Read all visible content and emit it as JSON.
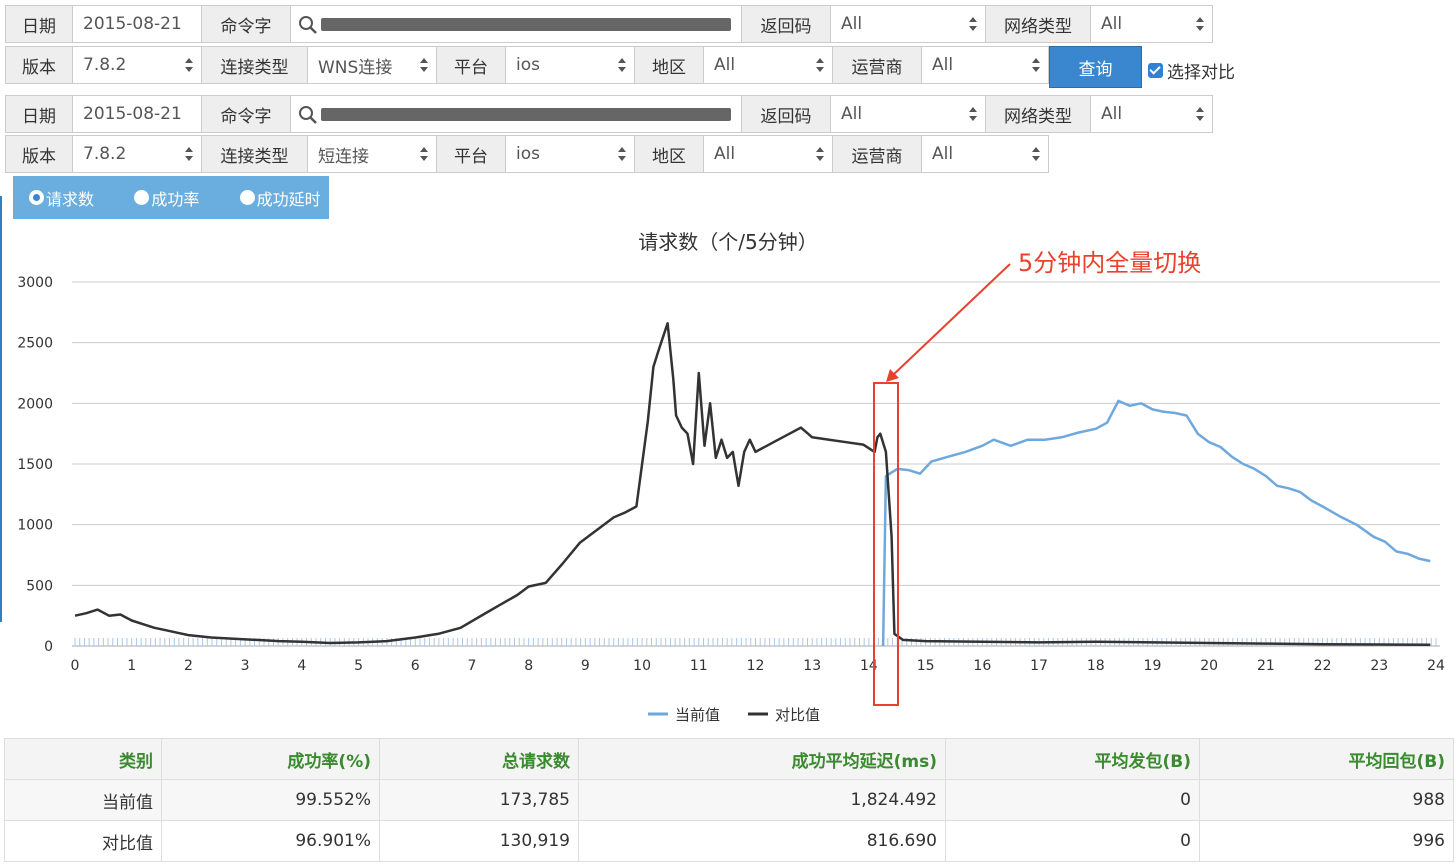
{
  "filters": [
    {
      "date_label": "日期",
      "date_value": "2015-08-21",
      "cmd_label": "命令字",
      "ret_label": "返回码",
      "ret_value": "All",
      "net_label": "网络类型",
      "net_value": "All"
    },
    {
      "ver_label": "版本",
      "ver_value": "7.8.2",
      "conn_label": "连接类型",
      "conn_value": "WNS连接",
      "plat_label": "平台",
      "plat_value": "ios",
      "region_label": "地区",
      "region_value": "All",
      "isp_label": "运营商",
      "isp_value": "All"
    },
    {
      "date_label": "日期",
      "date_value": "2015-08-21",
      "cmd_label": "命令字",
      "ret_label": "返回码",
      "ret_value": "All",
      "net_label": "网络类型",
      "net_value": "All"
    },
    {
      "ver_label": "版本",
      "ver_value": "7.8.2",
      "conn_label": "连接类型",
      "conn_value": "短连接",
      "plat_label": "平台",
      "plat_value": "ios",
      "region_label": "地区",
      "region_value": "All",
      "isp_label": "运营商",
      "isp_value": "All"
    }
  ],
  "query_label": "查询",
  "compare_label": "选择对比",
  "compare_checked": true,
  "metrics": [
    {
      "label": "请求数",
      "selected": true
    },
    {
      "label": "成功率",
      "selected": false
    },
    {
      "label": "成功延时",
      "selected": false
    }
  ],
  "annotation": "5分钟内全量切换",
  "colors": {
    "current": "#6fa8dc",
    "compare": "#333333",
    "annotation": "#e8422e",
    "accent": "#3b87cf"
  },
  "chart_data": {
    "type": "line",
    "title": "请求数（个/5分钟）",
    "xlim": [
      0,
      24
    ],
    "ylim": [
      0,
      3000
    ],
    "x_ticks": [
      0,
      1,
      2,
      3,
      4,
      5,
      6,
      7,
      8,
      9,
      10,
      11,
      12,
      13,
      14,
      15,
      16,
      17,
      18,
      19,
      20,
      21,
      22,
      23,
      24
    ],
    "y_ticks": [
      0,
      500,
      1000,
      1500,
      2000,
      2500,
      3000
    ],
    "grid": true,
    "legend": "bottom",
    "series": [
      {
        "name": "当前值",
        "color": "#6fa8dc",
        "points": [
          [
            14.25,
            0
          ],
          [
            14.3,
            1400
          ],
          [
            14.5,
            1460
          ],
          [
            14.7,
            1450
          ],
          [
            14.9,
            1420
          ],
          [
            15.1,
            1520
          ],
          [
            15.4,
            1560
          ],
          [
            15.7,
            1600
          ],
          [
            16.0,
            1650
          ],
          [
            16.2,
            1700
          ],
          [
            16.5,
            1650
          ],
          [
            16.8,
            1700
          ],
          [
            17.1,
            1700
          ],
          [
            17.4,
            1720
          ],
          [
            17.7,
            1760
          ],
          [
            18.0,
            1790
          ],
          [
            18.2,
            1840
          ],
          [
            18.4,
            2020
          ],
          [
            18.6,
            1980
          ],
          [
            18.8,
            2000
          ],
          [
            19.0,
            1950
          ],
          [
            19.2,
            1930
          ],
          [
            19.4,
            1920
          ],
          [
            19.6,
            1900
          ],
          [
            19.8,
            1750
          ],
          [
            20.0,
            1680
          ],
          [
            20.2,
            1640
          ],
          [
            20.4,
            1560
          ],
          [
            20.6,
            1500
          ],
          [
            20.8,
            1460
          ],
          [
            21.0,
            1400
          ],
          [
            21.2,
            1320
          ],
          [
            21.4,
            1300
          ],
          [
            21.6,
            1270
          ],
          [
            21.8,
            1200
          ],
          [
            22.0,
            1150
          ],
          [
            22.3,
            1070
          ],
          [
            22.6,
            1000
          ],
          [
            22.9,
            900
          ],
          [
            23.1,
            860
          ],
          [
            23.3,
            780
          ],
          [
            23.5,
            760
          ],
          [
            23.7,
            720
          ],
          [
            23.9,
            700
          ]
        ]
      },
      {
        "name": "对比值",
        "color": "#333333",
        "points": [
          [
            0.0,
            250
          ],
          [
            0.2,
            270
          ],
          [
            0.4,
            300
          ],
          [
            0.6,
            250
          ],
          [
            0.8,
            260
          ],
          [
            1.0,
            210
          ],
          [
            1.2,
            180
          ],
          [
            1.4,
            150
          ],
          [
            1.6,
            130
          ],
          [
            1.8,
            110
          ],
          [
            2.0,
            90
          ],
          [
            2.4,
            70
          ],
          [
            2.8,
            60
          ],
          [
            3.2,
            50
          ],
          [
            3.6,
            40
          ],
          [
            4.0,
            35
          ],
          [
            4.5,
            25
          ],
          [
            5.0,
            30
          ],
          [
            5.5,
            40
          ],
          [
            6.0,
            70
          ],
          [
            6.4,
            100
          ],
          [
            6.8,
            150
          ],
          [
            7.2,
            260
          ],
          [
            7.5,
            340
          ],
          [
            7.8,
            420
          ],
          [
            8.0,
            490
          ],
          [
            8.3,
            520
          ],
          [
            8.6,
            680
          ],
          [
            8.9,
            850
          ],
          [
            9.1,
            920
          ],
          [
            9.3,
            990
          ],
          [
            9.5,
            1060
          ],
          [
            9.7,
            1100
          ],
          [
            9.9,
            1150
          ],
          [
            10.0,
            1500
          ],
          [
            10.1,
            1850
          ],
          [
            10.2,
            2300
          ],
          [
            10.3,
            2450
          ],
          [
            10.45,
            2660
          ],
          [
            10.55,
            2200
          ],
          [
            10.6,
            1900
          ],
          [
            10.7,
            1800
          ],
          [
            10.8,
            1750
          ],
          [
            10.9,
            1500
          ],
          [
            11.0,
            2250
          ],
          [
            11.1,
            1650
          ],
          [
            11.2,
            2000
          ],
          [
            11.3,
            1550
          ],
          [
            11.4,
            1700
          ],
          [
            11.5,
            1550
          ],
          [
            11.6,
            1600
          ],
          [
            11.7,
            1320
          ],
          [
            11.8,
            1600
          ],
          [
            11.9,
            1700
          ],
          [
            12.0,
            1600
          ],
          [
            12.2,
            1650
          ],
          [
            12.4,
            1700
          ],
          [
            12.6,
            1750
          ],
          [
            12.8,
            1800
          ],
          [
            13.0,
            1720
          ],
          [
            13.3,
            1700
          ],
          [
            13.6,
            1680
          ],
          [
            13.9,
            1660
          ],
          [
            14.1,
            1600
          ],
          [
            14.15,
            1720
          ],
          [
            14.2,
            1750
          ],
          [
            14.3,
            1600
          ],
          [
            14.4,
            900
          ],
          [
            14.45,
            100
          ],
          [
            14.6,
            50
          ],
          [
            15.0,
            40
          ],
          [
            16.0,
            35
          ],
          [
            17.0,
            30
          ],
          [
            18.0,
            35
          ],
          [
            19.0,
            30
          ],
          [
            20.0,
            25
          ],
          [
            21.0,
            20
          ],
          [
            22.0,
            15
          ],
          [
            23.0,
            12
          ],
          [
            23.9,
            10
          ]
        ]
      }
    ]
  },
  "table": {
    "headers": [
      "类别",
      "成功率(%)",
      "总请求数",
      "成功平均延迟(ms)",
      "平均发包(B)",
      "平均回包(B)"
    ],
    "rows": [
      [
        "当前值",
        "99.552%",
        "173,785",
        "1,824.492",
        "0",
        "988"
      ],
      [
        "对比值",
        "96.901%",
        "130,919",
        "816.690",
        "0",
        "996"
      ]
    ]
  }
}
